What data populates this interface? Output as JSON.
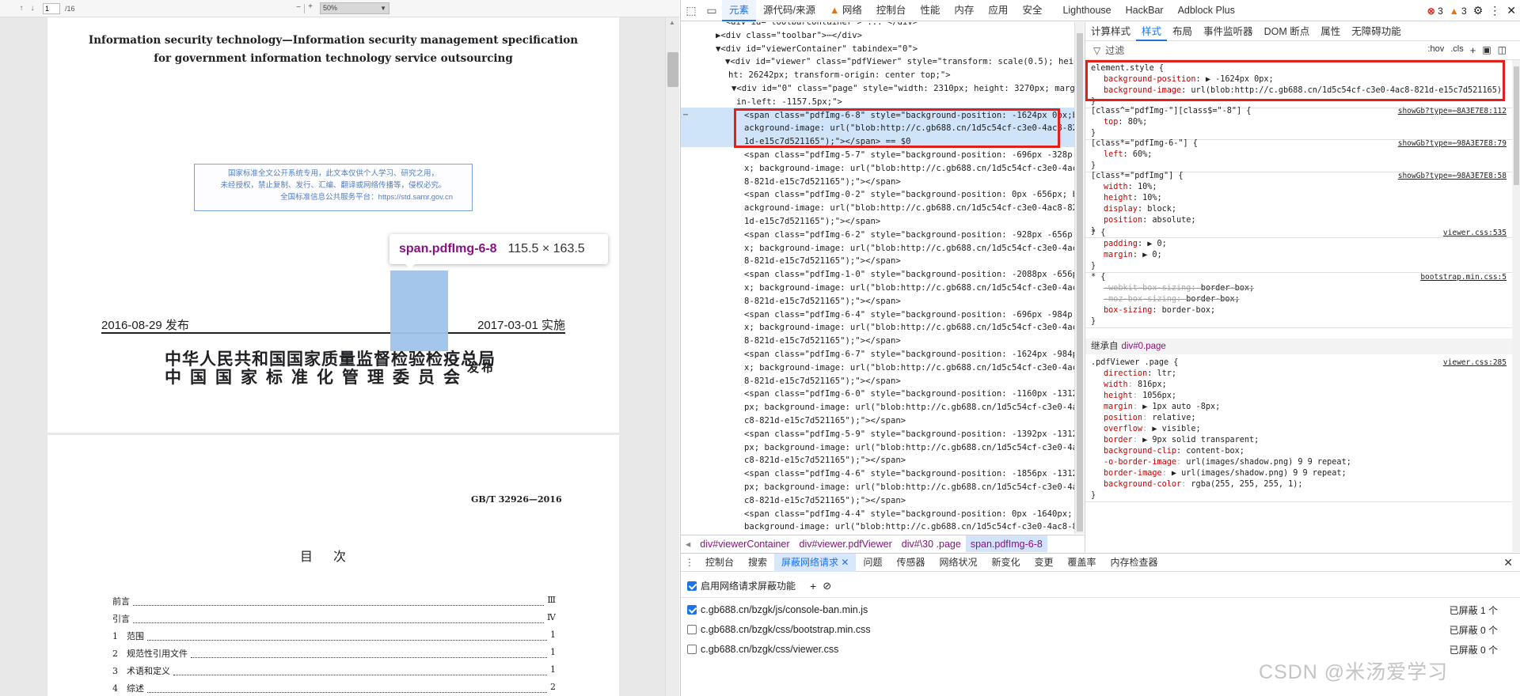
{
  "pdf": {
    "toolbar": {
      "page_value": "1",
      "page_count": "/16",
      "zoom": "50%",
      "zoom_out": "−",
      "zoom_in": "+"
    },
    "cover_title_line1": "Information security technology—Information security management specification",
    "cover_title_line2": "for government information technology service outsourcing",
    "stamp_line1": "国家标准全文公开系统专用，此文本仅供个人学习、研究之用，",
    "stamp_line2": "未经授权，禁止复制、发行、汇编、翻译或网络传播等，侵权必究。",
    "stamp_line3": "全国标准信息公共服务平台：https://std.samr.gov.cn",
    "tooltip_name": "span.pdfImg-6-8",
    "tooltip_size": "115.5 × 163.5",
    "pub_date": "2016-08-29 发布",
    "impl_date": "2017-03-01 实施",
    "org_line1": "中华人民共和国国家质量监督检验检疫总局",
    "org_line2": "中国国家标准化管理委员会",
    "fabu": "发布",
    "std_code": "GB/T 32926—2016",
    "toc_title": "目次",
    "toc": [
      {
        "label": "前言",
        "page": "Ⅲ"
      },
      {
        "label": "引言",
        "page": "Ⅳ"
      },
      {
        "label": "1　范围",
        "page": "1"
      },
      {
        "label": "2　规范性引用文件",
        "page": "1"
      },
      {
        "label": "3　术语和定义",
        "page": "1"
      },
      {
        "label": "4　综述",
        "page": "2"
      }
    ]
  },
  "devtools": {
    "main_tabs": [
      "元素",
      "源代码/来源",
      "网络",
      "控制台",
      "性能",
      "内存",
      "应用",
      "安全",
      "Lighthouse",
      "HackBar",
      "Adblock Plus"
    ],
    "errors": "3",
    "warnings": "3",
    "elements": {
      "lines": [
        {
          "t": "  <div id=\"toolbarContainer\"> ... </div>",
          "i": 44
        },
        {
          "t": "▶<div class=\"toolbar\">⋯</div>",
          "i": 44
        },
        {
          "t": "▼<div id=\"viewerContainer\" tabindex=\"0\">",
          "i": 44
        },
        {
          "t": "▼<div id=\"viewer\" class=\"pdfViewer\" style=\"transform: scale(0.5); heig",
          "i": 56
        },
        {
          "t": "ht: 26242px; transform-origin: center top;\">",
          "i": 60
        },
        {
          "t": "▼<div id=\"0\" class=\"page\" style=\"width: 2310px; height: 3270px; marg",
          "i": 64
        },
        {
          "t": "in-left: -1157.5px;\">",
          "i": 70
        },
        {
          "t": "<span class=\"pdfImg-6-8\" style=\"background-position: -1624px 0px;b",
          "i": 80
        },
        {
          "t": "ackground-image: url(\"blob:http://c.gb688.cn/1d5c54cf-c3e0-4ac8-82",
          "i": 80
        },
        {
          "t": "1d-e15c7d521165\");\"></span> == $0",
          "i": 80
        },
        {
          "t": "<span class=\"pdfImg-5-7\" style=\"background-position: -696px -328p",
          "i": 80
        },
        {
          "t": "x; background-image: url(\"blob:http://c.gb688.cn/1d5c54cf-c3e0-4ac",
          "i": 80
        },
        {
          "t": "8-821d-e15c7d521165\");\"></span>",
          "i": 80
        },
        {
          "t": "<span class=\"pdfImg-0-2\" style=\"background-position: 0px -656px; b",
          "i": 80
        },
        {
          "t": "ackground-image: url(\"blob:http://c.gb688.cn/1d5c54cf-c3e0-4ac8-82",
          "i": 80
        },
        {
          "t": "1d-e15c7d521165\");\"></span>",
          "i": 80
        },
        {
          "t": "<span class=\"pdfImg-6-2\" style=\"background-position: -928px -656p",
          "i": 80
        },
        {
          "t": "x; background-image: url(\"blob:http://c.gb688.cn/1d5c54cf-c3e0-4ac",
          "i": 80
        },
        {
          "t": "8-821d-e15c7d521165\");\"></span>",
          "i": 80
        },
        {
          "t": "<span class=\"pdfImg-1-0\" style=\"background-position: -2088px -656p",
          "i": 80
        },
        {
          "t": "x; background-image: url(\"blob:http://c.gb688.cn/1d5c54cf-c3e0-4ac",
          "i": 80
        },
        {
          "t": "8-821d-e15c7d521165\");\"></span>",
          "i": 80
        },
        {
          "t": "<span class=\"pdfImg-6-4\" style=\"background-position: -696px -984p",
          "i": 80
        },
        {
          "t": "x; background-image: url(\"blob:http://c.gb688.cn/1d5c54cf-c3e0-4ac",
          "i": 80
        },
        {
          "t": "8-821d-e15c7d521165\");\"></span>",
          "i": 80
        },
        {
          "t": "<span class=\"pdfImg-6-7\" style=\"background-position: -1624px -984p",
          "i": 80
        },
        {
          "t": "x; background-image: url(\"blob:http://c.gb688.cn/1d5c54cf-c3e0-4ac",
          "i": 80
        },
        {
          "t": "8-821d-e15c7d521165\");\"></span>",
          "i": 80
        },
        {
          "t": "<span class=\"pdfImg-6-0\" style=\"background-position: -1160px -1312",
          "i": 80
        },
        {
          "t": "px; background-image: url(\"blob:http://c.gb688.cn/1d5c54cf-c3e0-4a",
          "i": 80
        },
        {
          "t": "c8-821d-e15c7d521165\");\"></span>",
          "i": 80
        },
        {
          "t": "<span class=\"pdfImg-5-9\" style=\"background-position: -1392px -1312",
          "i": 80
        },
        {
          "t": "px; background-image: url(\"blob:http://c.gb688.cn/1d5c54cf-c3e0-4a",
          "i": 80
        },
        {
          "t": "c8-821d-e15c7d521165\");\"></span>",
          "i": 80
        },
        {
          "t": "<span class=\"pdfImg-4-6\" style=\"background-position: -1856px -1312",
          "i": 80
        },
        {
          "t": "px; background-image: url(\"blob:http://c.gb688.cn/1d5c54cf-c3e0-4a",
          "i": 80
        },
        {
          "t": "c8-821d-e15c7d521165\");\"></span>",
          "i": 80
        },
        {
          "t": "<span class=\"pdfImg-4-4\" style=\"background-position: 0px -1640px;",
          "i": 80
        },
        {
          "t": "background-image: url(\"blob:http://c.gb688.cn/1d5c54cf-c3e0-4ac8-8",
          "i": 80
        }
      ]
    },
    "breadcrumbs": [
      "div#viewerContainer",
      "div#viewer.pdfViewer",
      "div#\\30 .page",
      "span.pdfImg-6-8"
    ],
    "style_tabs": [
      "计算样式",
      "样式",
      "布局",
      "事件监听器",
      "DOM 断点",
      "属性",
      "无障碍功能"
    ],
    "filter_placeholder": "过滤",
    "filter_hov": ":hov",
    "filter_cls": ".cls",
    "inherited_label": "继承自",
    "inherited_target": "div#0.page",
    "rules": [
      {
        "selector": "element.style {",
        "source": "",
        "props": [
          {
            "n": "background-position",
            "v": "▶ -1624px 0px;"
          },
          {
            "n": "background-image",
            "v": "url(blob:http://c.gb688.cn/1d5c54cf-c3e0-4ac8-821d-e15c7d521165);"
          }
        ]
      },
      {
        "selector": "[class^=\"pdfImg-\"][class$=\"-8\"] {",
        "source": "showGb?type=⋯8A3E7E8:112",
        "props": [
          {
            "n": "top",
            "v": "80%;"
          }
        ]
      },
      {
        "selector": "[class*=\"pdfImg-6-\"] {",
        "source": "showGb?type=⋯98A3E7E8:79",
        "props": [
          {
            "n": "left",
            "v": "60%;"
          }
        ]
      },
      {
        "selector": "[class*=\"pdfImg\"] {",
        "source": "showGb?type=⋯98A3E7E8:58",
        "props": [
          {
            "n": "width",
            "v": "10%;"
          },
          {
            "n": "height",
            "v": "10%;"
          },
          {
            "n": "display",
            "v": "block;"
          },
          {
            "n": "position",
            "v": "absolute;"
          }
        ]
      },
      {
        "selector": "* {",
        "source": "viewer.css:535",
        "props": [
          {
            "n": "padding",
            "v": "▶ 0;"
          },
          {
            "n": "margin",
            "v": "▶ 0;"
          }
        ]
      },
      {
        "selector": "* {",
        "source": "bootstrap.min.css:5",
        "props": [
          {
            "n": "-webkit-box-sizing",
            "v": "border-box;"
          },
          {
            "n": "-moz-box-sizing",
            "v": "border-box;"
          },
          {
            "n": "box-sizing",
            "v": "border-box;"
          }
        ]
      }
    ],
    "page_rule": {
      "selector": ".pdfViewer .page {",
      "source": "viewer.css:285",
      "props": [
        {
          "n": "direction",
          "v": "ltr;"
        },
        {
          "n": "width",
          "v": "816px;"
        },
        {
          "n": "height",
          "v": "1056px;"
        },
        {
          "n": "margin",
          "v": "▶ 1px auto -8px;"
        },
        {
          "n": "position",
          "v": "relative;"
        },
        {
          "n": "overflow",
          "v": "▶ visible;"
        },
        {
          "n": "border",
          "v": "▶ 9px solid  transparent;"
        },
        {
          "n": "background-clip",
          "v": "content-box;"
        },
        {
          "n": "-o-border-image",
          "v": "url(images/shadow.png) 9 9 repeat;"
        },
        {
          "n": "border-image",
          "v": "▶ url(images/shadow.png) 9 9 repeat;"
        },
        {
          "n": "background-color",
          "v": "rgba(255, 255, 255, 1);"
        }
      ]
    },
    "drawer_tabs": [
      "控制台",
      "搜索",
      "屏蔽网络请求",
      "问题",
      "传感器",
      "网络状况",
      "新变化",
      "变更",
      "覆盖率",
      "内存检查器"
    ],
    "enable_label": "启用网络请求屏蔽功能",
    "requests": [
      {
        "url": "c.gb688.cn/bzgk/js/console-ban.min.js",
        "checked": true,
        "count": "已屏蔽 1 个"
      },
      {
        "url": "c.gb688.cn/bzgk/css/bootstrap.min.css",
        "checked": false,
        "count": "已屏蔽 0 个"
      },
      {
        "url": "c.gb688.cn/bzgk/css/viewer.css",
        "checked": false,
        "count": "已屏蔽 0 个"
      }
    ]
  },
  "watermark": "CSDN @米汤爱学习"
}
